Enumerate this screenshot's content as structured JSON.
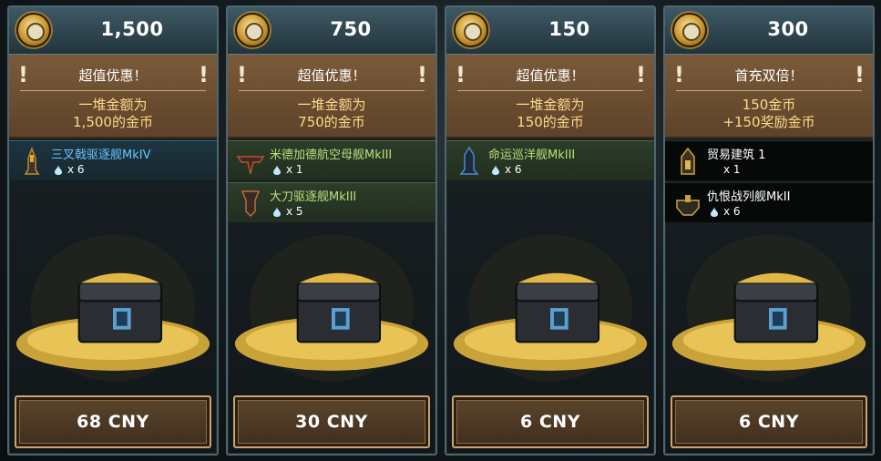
{
  "offers": [
    {
      "amount": "1,500",
      "deal_title": "超值优惠！",
      "deal_desc_line1": "一堆金额为",
      "deal_desc_line2": "1,500的金币",
      "bonuses": [
        {
          "name": "三叉戟驱逐舰MkIV",
          "qty": "x 6",
          "style": "blue"
        }
      ],
      "price": "68 CNY"
    },
    {
      "amount": "750",
      "deal_title": "超值优惠！",
      "deal_desc_line1": "一堆金额为",
      "deal_desc_line2": "750的金币",
      "bonuses": [
        {
          "name": "米德加德航空母舰MkIII",
          "qty": "x 1",
          "style": "green"
        },
        {
          "name": "大刀驱逐舰MkIII",
          "qty": "x 5",
          "style": "green"
        }
      ],
      "price": "30 CNY"
    },
    {
      "amount": "150",
      "deal_title": "超值优惠！",
      "deal_desc_line1": "一堆金额为",
      "deal_desc_line2": "150的金币",
      "bonuses": [
        {
          "name": "命运巡洋舰MkIII",
          "qty": "x 6",
          "style": "green"
        }
      ],
      "price": "6 CNY"
    },
    {
      "amount": "300",
      "deal_title": "首充双倍！",
      "deal_desc_line1": "150金币",
      "deal_desc_line2": "+150奖励金币",
      "bonuses": [
        {
          "name": "贸易建筑 1",
          "qty": "x 1",
          "style": "black"
        },
        {
          "name": "仇恨战列舰MkII",
          "qty": "x 6",
          "style": "black"
        }
      ],
      "price": "6 CNY"
    }
  ],
  "icons": {
    "currency": "gold-medal-icon",
    "bonus_unit": "water-drop-icon",
    "ship": "ship-icon",
    "chest": "gold-chest-icon"
  },
  "colors": {
    "header": "#2e4650",
    "deal_banner": "#6b4e32",
    "deal_text": "#ffd98a",
    "bonus_blue": "#66c6ff",
    "bonus_green": "#b9e07a",
    "buy_button_border": "#c9a371"
  }
}
